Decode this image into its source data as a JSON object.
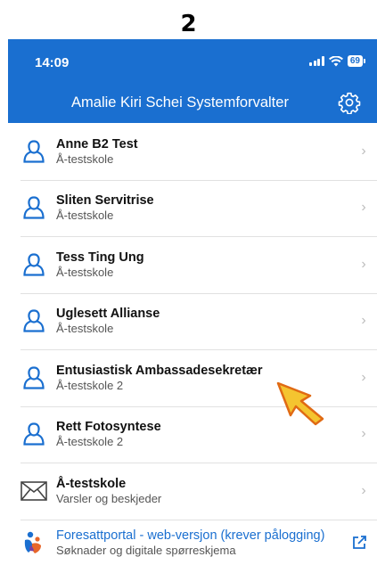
{
  "step": "2",
  "status_bar": {
    "time": "14:09",
    "battery": "69"
  },
  "header": {
    "title": "Amalie Kiri Schei Systemforvalter",
    "settings_icon": "gear-icon"
  },
  "colors": {
    "brand": "#1a6fd0",
    "icon": "#1a6fd0",
    "chevron": "#bdbdbd",
    "cursor": "#f4c430"
  },
  "contacts": [
    {
      "name": "Anne B2 Test",
      "school": "Å-testskole"
    },
    {
      "name": "Sliten Servitrise",
      "school": "Å-testskole"
    },
    {
      "name": "Tess Ting Ung",
      "school": "Å-testskole"
    },
    {
      "name": "Uglesett Allianse",
      "school": "Å-testskole"
    },
    {
      "name": "Entusiastisk Ambassadesekretær",
      "school": "Å-testskole 2"
    },
    {
      "name": "Rett Fotosyntese",
      "school": "Å-testskole 2"
    }
  ],
  "school_messages": {
    "title": "Å-testskole",
    "subtitle": "Varsler og beskjeder"
  },
  "portal": {
    "title": "Foresattportal - web-versjon (krever pålogging)",
    "subtitle": "Søknader og digitale spørreskjema"
  }
}
